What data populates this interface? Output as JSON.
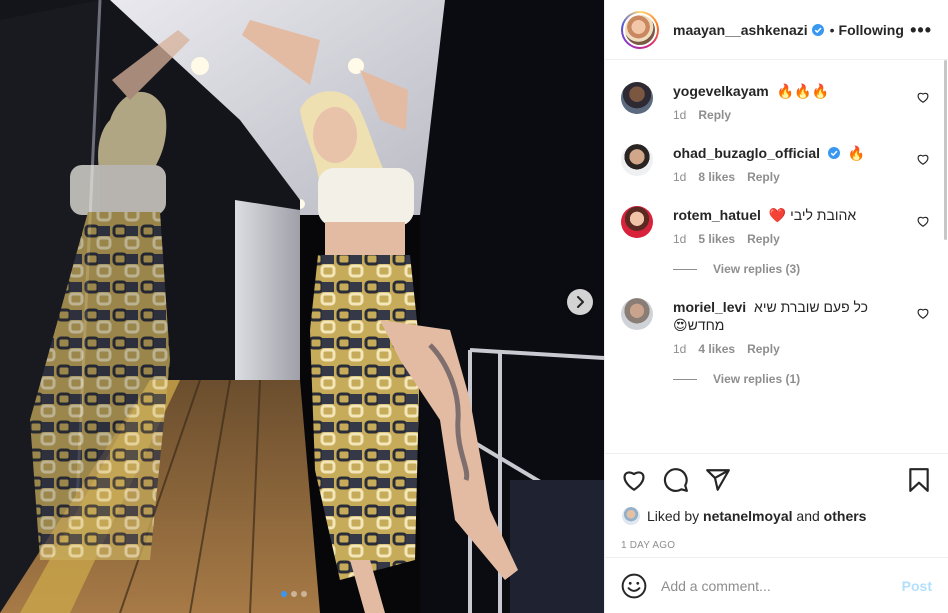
{
  "post": {
    "author": {
      "username": "maayan__ashkenazi",
      "verified": true
    },
    "separator": "•",
    "follow_status": "Following",
    "more_icon": "ellipsis-icon",
    "carousel": {
      "count": 3,
      "active_index": 0,
      "next_icon": "chevron-right-icon"
    }
  },
  "comments": [
    {
      "username": "yogevelkayam",
      "text": "🔥🔥🔥",
      "time": "1d",
      "likes": "",
      "reply_label": "Reply",
      "view_replies": ""
    },
    {
      "username": "ohad_buzaglo_official",
      "verified": true,
      "text": "🔥",
      "time": "1d",
      "likes": "8 likes",
      "reply_label": "Reply",
      "view_replies": ""
    },
    {
      "username": "rotem_hatuel",
      "text": "אהובת ליבי ❤️",
      "time": "1d",
      "likes": "5 likes",
      "reply_label": "Reply",
      "view_replies": "View replies (3)"
    },
    {
      "username": "moriel_levi",
      "text": "כל פעם שוברת שיא מחדש😍",
      "time": "1d",
      "likes": "4 likes",
      "reply_label": "Reply",
      "view_replies": "View replies (1)"
    }
  ],
  "actions": {
    "icons": [
      "heart-icon",
      "comment-icon",
      "share-icon",
      "bookmark-icon"
    ]
  },
  "likes_summary": {
    "prefix": "Liked by",
    "user": "netanelmoyal",
    "joiner": "and",
    "suffix": "others"
  },
  "timestamp": "1 DAY AGO",
  "composer": {
    "placeholder": "Add a comment...",
    "post_label": "Post",
    "emoji_icon": "smiley-icon"
  },
  "colors": {
    "accent": "#0095f6",
    "verified": "#3897f0",
    "muted": "#8e8e8e",
    "post_disabled": "#b2dffc"
  }
}
